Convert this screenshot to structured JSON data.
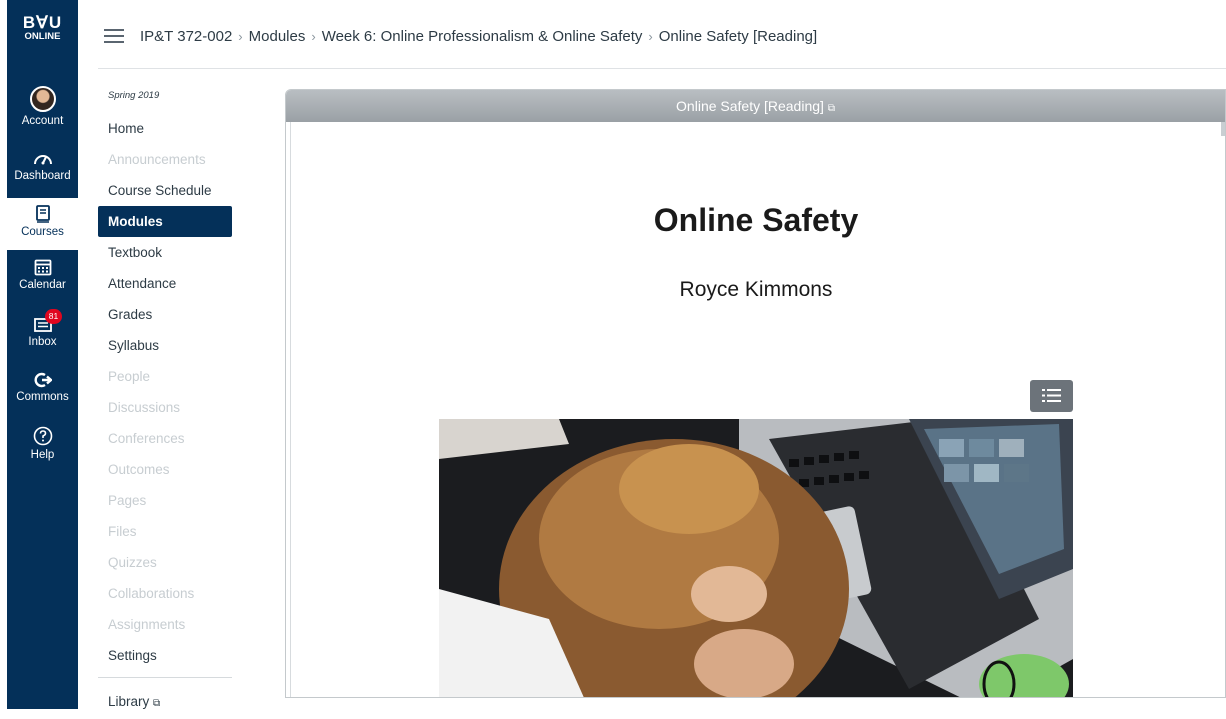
{
  "logo": {
    "line1": "B∀U",
    "line2": "ONLINE"
  },
  "global_nav": [
    {
      "label": "Account"
    },
    {
      "label": "Dashboard"
    },
    {
      "label": "Courses"
    },
    {
      "label": "Calendar"
    },
    {
      "label": "Inbox",
      "badge": "81"
    },
    {
      "label": "Commons"
    },
    {
      "label": "Help"
    }
  ],
  "breadcrumb": [
    "IP&T 372-002",
    "Modules",
    "Week 6: Online Professionalism & Online Safety",
    "Online Safety [Reading]"
  ],
  "course_nav": {
    "term": "Spring 2019",
    "items": [
      {
        "label": "Home",
        "state": "enabled"
      },
      {
        "label": "Announcements",
        "state": "disabled"
      },
      {
        "label": "Course Schedule",
        "state": "enabled"
      },
      {
        "label": "Modules",
        "state": "active"
      },
      {
        "label": "Textbook",
        "state": "enabled"
      },
      {
        "label": "Attendance",
        "state": "enabled"
      },
      {
        "label": "Grades",
        "state": "enabled"
      },
      {
        "label": "Syllabus",
        "state": "enabled"
      },
      {
        "label": "People",
        "state": "disabled"
      },
      {
        "label": "Discussions",
        "state": "disabled"
      },
      {
        "label": "Conferences",
        "state": "disabled"
      },
      {
        "label": "Outcomes",
        "state": "disabled"
      },
      {
        "label": "Pages",
        "state": "disabled"
      },
      {
        "label": "Files",
        "state": "disabled"
      },
      {
        "label": "Quizzes",
        "state": "disabled"
      },
      {
        "label": "Collaborations",
        "state": "disabled"
      },
      {
        "label": "Assignments",
        "state": "disabled"
      },
      {
        "label": "Settings",
        "state": "enabled"
      }
    ],
    "library": "Library"
  },
  "content": {
    "frame_title": "Online Safety [Reading]",
    "title": "Online Safety",
    "author": "Royce Kimmons"
  },
  "colors": {
    "nav_bg": "#043059",
    "active_item": "#043059",
    "badge": "#e0061f"
  }
}
